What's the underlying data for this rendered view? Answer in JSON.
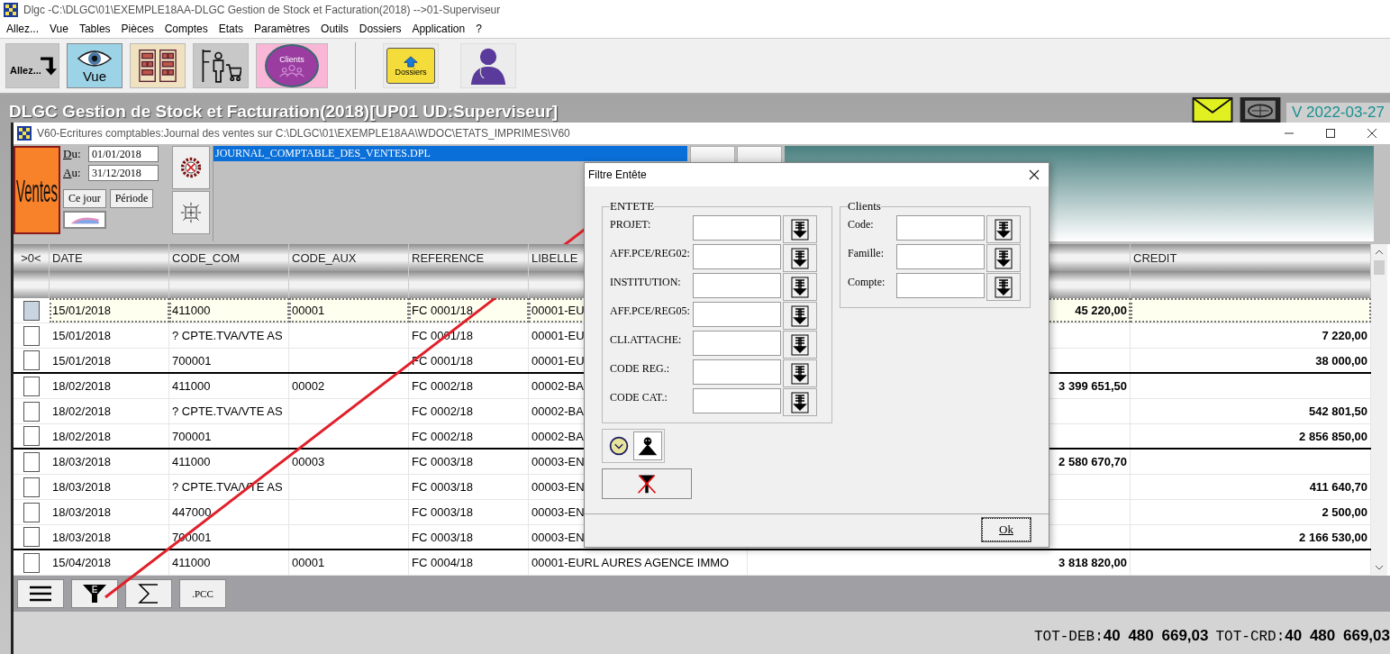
{
  "window": {
    "title": "Dlgc -C:\\DLGC\\01\\EXEMPLE18AA-DLGC Gestion de Stock et Facturation(2018) -->01-Superviseur"
  },
  "menu": [
    "Allez...",
    "Vue",
    "Tables",
    "Pièces",
    "Comptes",
    "Etats",
    "Paramètres",
    "Outils",
    "Dossiers",
    "Application",
    "?"
  ],
  "toolbar": [
    {
      "kind": "goto",
      "label": "Allez..."
    },
    {
      "kind": "view",
      "label": "Vue"
    },
    {
      "kind": "tables"
    },
    {
      "kind": "stock"
    },
    {
      "kind": "clients",
      "label": "Clients"
    },
    {
      "kind": "folder",
      "label": "Dossiers"
    },
    {
      "kind": "user"
    }
  ],
  "desktop": {
    "title": "DLGC Gestion de Stock et Facturation(2018)[UP01 UD:Superviseur]",
    "version": "V 2022-03-27"
  },
  "child_window": {
    "title": "V60-Ecritures comptables:Journal des ventes sur C:\\DLGC\\01\\EXEMPLE18AA\\WDOC\\ETATS_IMPRIMES\\V60",
    "journal_button": "Ventes",
    "from_label": "Du:",
    "from_value": "01/01/2018",
    "to_label": "Au:",
    "to_value": "31/12/2018",
    "buttons": [
      "Ce jour",
      "Période"
    ],
    "files": [
      {
        "name": "JOURNAL_COMPTABLE_DES_VENTES.DPL",
        "selected": true
      }
    ]
  },
  "table": {
    "columns": [
      ">0<",
      "DATE",
      "CODE_COM",
      "CODE_AUX",
      "REFERENCE",
      "LIBELLE",
      "CREDIT"
    ],
    "rows": [
      {
        "selected": true,
        "checked": false,
        "group_end": false,
        "date": "15/01/2018",
        "code_com": "411000",
        "code_aux": "00001",
        "reference": "FC 0001/18",
        "libelle": "00001-EU",
        "column_7": "45 220,00"
      },
      {
        "selected": false,
        "checked": false,
        "group_end": false,
        "date": "15/01/2018",
        "code_com": "? CPTE.TVA/VTE AS",
        "reference": "FC 0001/18",
        "libelle": "00001-EU",
        "credit": "7 220,00"
      },
      {
        "selected": false,
        "checked": false,
        "group_end": true,
        "date": "15/01/2018",
        "code_com": "700001",
        "reference": "FC 0001/18",
        "libelle": "00001-EU",
        "credit": "38 000,00"
      },
      {
        "selected": false,
        "checked": false,
        "group_end": false,
        "date": "18/02/2018",
        "code_com": "411000",
        "code_aux": "00002",
        "reference": "FC 0002/18",
        "libelle": "00002-BA",
        "column_7": "3 399 651,50"
      },
      {
        "selected": false,
        "checked": false,
        "group_end": false,
        "date": "18/02/2018",
        "code_com": "? CPTE.TVA/VTE AS",
        "reference": "FC 0002/18",
        "libelle": "00002-BA",
        "credit": "542 801,50"
      },
      {
        "selected": false,
        "checked": false,
        "group_end": true,
        "date": "18/02/2018",
        "code_com": "700001",
        "reference": "FC 0002/18",
        "libelle": "00002-BA",
        "credit": "2 856 850,00"
      },
      {
        "selected": false,
        "checked": false,
        "group_end": false,
        "date": "18/03/2018",
        "code_com": "411000",
        "code_aux": "00003",
        "reference": "FC 0003/18",
        "libelle": "00003-EN",
        "column_7": "2 580 670,70"
      },
      {
        "selected": false,
        "checked": false,
        "group_end": false,
        "date": "18/03/2018",
        "code_com": "? CPTE.TVA/VTE AS",
        "reference": "FC 0003/18",
        "libelle": "00003-EN",
        "credit": "411 640,70"
      },
      {
        "selected": false,
        "checked": false,
        "group_end": false,
        "date": "18/03/2018",
        "code_com": "447000",
        "reference": "FC 0003/18",
        "libelle": "00003-EN",
        "credit": "2 500,00"
      },
      {
        "selected": false,
        "checked": false,
        "group_end": true,
        "date": "18/03/2018",
        "code_com": "700001",
        "reference": "FC 0003/18",
        "libelle": "00003-EN",
        "credit": "2 166 530,00"
      },
      {
        "selected": false,
        "checked": false,
        "group_end": false,
        "date": "15/04/2018",
        "code_com": "411000",
        "code_aux": "00001",
        "reference": "FC 0004/18",
        "libelle": "00001-EURL AURES AGENCE IMMO",
        "column_7": "3 818 820,00"
      }
    ]
  },
  "bottom_tools": [
    {
      "kind": "menu"
    },
    {
      "kind": "filter",
      "label": "E"
    },
    {
      "kind": "sum"
    },
    {
      "kind": "text",
      "label": ".PCC"
    }
  ],
  "totals": [
    {
      "label": "TOT-DEB:",
      "value": "40 480 669,03"
    },
    {
      "label": "TOT-CRD:",
      "value": "40 480 669,03"
    }
  ],
  "dialog": {
    "title": "Filtre Entête",
    "groups": [
      {
        "title": "ENTETE",
        "fields": [
          "PROJET:",
          "AFF.PCE/REG02:",
          "INSTITUTION:",
          "AFF.PCE/REG05:",
          "CLI.ATTACHE:",
          "CODE REG.:",
          "CODE CAT.:"
        ]
      },
      {
        "title": "Clients",
        "fields": [
          "Code:",
          "Famille:",
          "Compte:"
        ]
      }
    ],
    "ok": "Ok"
  }
}
